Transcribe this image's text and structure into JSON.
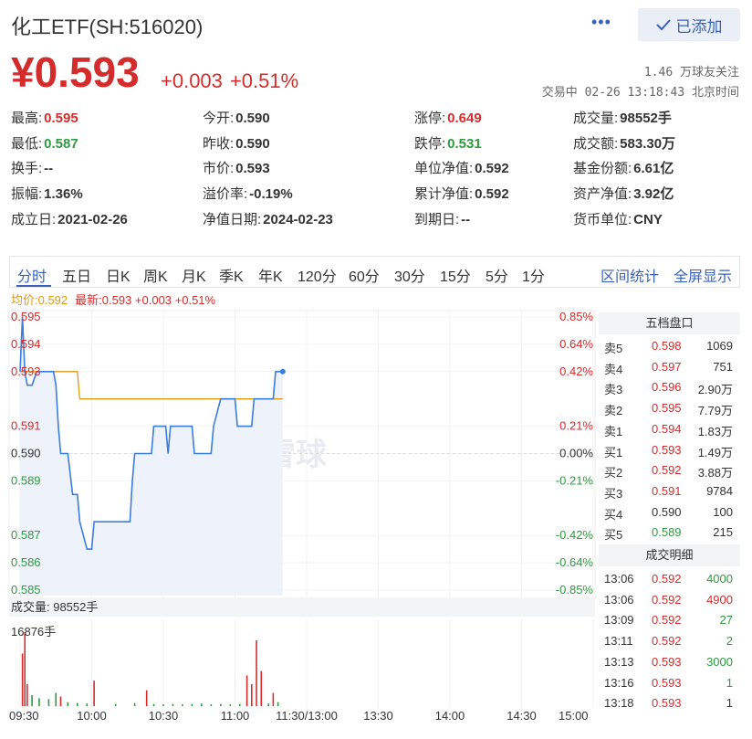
{
  "header": {
    "title": "化工ETF(SH:516020)",
    "more_label": "•••",
    "added_label": "已添加",
    "price": "¥0.593",
    "change": "+0.003",
    "change_pct": "+0.51%",
    "followers": "1.46 万球友关注",
    "trade_status": "交易中 02-26 13:18:43 北京时间"
  },
  "stats": [
    {
      "label": "最高:",
      "value": "0.595",
      "color": "red"
    },
    {
      "label": "今开:",
      "value": "0.590",
      "color": ""
    },
    {
      "label": "涨停:",
      "value": "0.649",
      "color": "red"
    },
    {
      "label": "成交量:",
      "value": "98552手",
      "color": ""
    },
    {
      "label": "最低:",
      "value": "0.587",
      "color": "green"
    },
    {
      "label": "昨收:",
      "value": "0.590",
      "color": ""
    },
    {
      "label": "跌停:",
      "value": "0.531",
      "color": "green"
    },
    {
      "label": "成交额:",
      "value": "583.30万",
      "color": ""
    },
    {
      "label": "换手:",
      "value": "--",
      "color": ""
    },
    {
      "label": "市价:",
      "value": "0.593",
      "color": ""
    },
    {
      "label": "单位净值:",
      "value": "0.592",
      "color": ""
    },
    {
      "label": "基金份额:",
      "value": "6.61亿",
      "color": ""
    },
    {
      "label": "振幅:",
      "value": "1.36%",
      "color": ""
    },
    {
      "label": "溢价率:",
      "value": "-0.19%",
      "color": ""
    },
    {
      "label": "累计净值:",
      "value": "0.592",
      "color": ""
    },
    {
      "label": "资产净值:",
      "value": "3.92亿",
      "color": ""
    },
    {
      "label": "成立日:",
      "value": "2021-02-26",
      "color": ""
    },
    {
      "label": "净值日期:",
      "value": "2024-02-23",
      "color": ""
    },
    {
      "label": "到期日:",
      "value": "--",
      "color": ""
    },
    {
      "label": "货币单位:",
      "value": "CNY",
      "color": ""
    }
  ],
  "tabs": [
    "分时",
    "五日",
    "日K",
    "周K",
    "月K",
    "季K",
    "年K",
    "120分",
    "60分",
    "30分",
    "15分",
    "5分",
    "1分"
  ],
  "tools": [
    "区间统计",
    "全屏显示"
  ],
  "legend": {
    "avg": "均价:0.592",
    "latest": "最新:0.593 +0.003 +0.51%"
  },
  "watermark": "雪球",
  "volume_header": "成交量: 98552手",
  "volume_max": "16876手",
  "order_book": {
    "title": "五档盘口",
    "asks": [
      {
        "label": "卖5",
        "price": "0.598",
        "vol": "1069"
      },
      {
        "label": "卖4",
        "price": "0.597",
        "vol": "751"
      },
      {
        "label": "卖3",
        "price": "0.596",
        "vol": "2.90万"
      },
      {
        "label": "卖2",
        "price": "0.595",
        "vol": "7.79万"
      },
      {
        "label": "卖1",
        "price": "0.594",
        "vol": "1.83万"
      }
    ],
    "bids": [
      {
        "label": "买1",
        "price": "0.593",
        "vol": "1.49万",
        "color": "red"
      },
      {
        "label": "买2",
        "price": "0.592",
        "vol": "3.88万",
        "color": "red"
      },
      {
        "label": "买3",
        "price": "0.591",
        "vol": "9784",
        "color": "red"
      },
      {
        "label": "买4",
        "price": "0.590",
        "vol": "100",
        "color": "neutral"
      },
      {
        "label": "买5",
        "price": "0.589",
        "vol": "215",
        "color": "green"
      }
    ]
  },
  "trades": {
    "title": "成交明细",
    "rows": [
      {
        "time": "13:06",
        "price": "0.592",
        "vol": "4000",
        "color": "green"
      },
      {
        "time": "13:06",
        "price": "0.592",
        "vol": "4900",
        "color": "red"
      },
      {
        "time": "13:09",
        "price": "0.592",
        "vol": "27",
        "color": "green"
      },
      {
        "time": "13:11",
        "price": "0.592",
        "vol": "2",
        "color": "green"
      },
      {
        "time": "13:13",
        "price": "0.593",
        "vol": "3000",
        "color": "green"
      },
      {
        "time": "13:16",
        "price": "0.593",
        "vol": "1",
        "color": "green"
      },
      {
        "time": "13:18",
        "price": "0.593",
        "vol": "1",
        "color": "neutral"
      }
    ]
  },
  "chart_data": {
    "type": "line",
    "y_ticks": [
      "0.595",
      "0.594",
      "0.593",
      "0.591",
      "0.590",
      "0.589",
      "0.587",
      "0.586",
      "0.585"
    ],
    "pct_ticks": [
      "0.85%",
      "0.64%",
      "0.42%",
      "0.21%",
      "0.00%",
      "-0.21%",
      "-0.42%",
      "-0.64%",
      "-0.85%"
    ],
    "x_ticks": [
      "09:30",
      "10:00",
      "10:30",
      "11:00",
      "11:30/13:00",
      "13:30",
      "14:00",
      "14:30",
      "15:00"
    ],
    "ylim": [
      0.585,
      0.595
    ],
    "prev_close": 0.59,
    "series": [
      {
        "name": "最新",
        "color": "#3b7ddd",
        "points": [
          [
            0,
            0.593
          ],
          [
            1,
            0.595
          ],
          [
            2,
            0.593
          ],
          [
            3,
            0.5925
          ],
          [
            5,
            0.5925
          ],
          [
            7,
            0.593
          ],
          [
            14,
            0.593
          ],
          [
            15,
            0.5925
          ],
          [
            16,
            0.591
          ],
          [
            17,
            0.59
          ],
          [
            20,
            0.59
          ],
          [
            22,
            0.5885
          ],
          [
            24,
            0.5885
          ],
          [
            25,
            0.5875
          ],
          [
            28,
            0.5865
          ],
          [
            30,
            0.5865
          ],
          [
            31,
            0.5875
          ],
          [
            46,
            0.5875
          ],
          [
            47,
            0.589
          ],
          [
            48,
            0.59
          ],
          [
            50,
            0.59
          ],
          [
            55,
            0.59
          ],
          [
            56,
            0.591
          ],
          [
            61,
            0.591
          ],
          [
            62,
            0.59
          ],
          [
            63,
            0.591
          ],
          [
            72,
            0.591
          ],
          [
            73,
            0.59
          ],
          [
            80,
            0.59
          ],
          [
            81,
            0.591
          ],
          [
            84,
            0.592
          ],
          [
            90,
            0.592
          ],
          [
            91,
            0.591
          ],
          [
            97,
            0.591
          ],
          [
            98,
            0.592
          ],
          [
            106,
            0.592
          ],
          [
            107,
            0.593
          ],
          [
            110,
            0.593
          ]
        ]
      },
      {
        "name": "均价",
        "color": "#e29a13",
        "points": [
          [
            0,
            0.593
          ],
          [
            1,
            0.593
          ],
          [
            24,
            0.593
          ],
          [
            25,
            0.592
          ],
          [
            110,
            0.592
          ]
        ]
      }
    ],
    "volume": [
      {
        "i": 1,
        "v": 12000,
        "c": "red"
      },
      {
        "i": 2,
        "v": 16876,
        "c": "red"
      },
      {
        "i": 3,
        "v": 5000,
        "c": "red"
      },
      {
        "i": 5,
        "v": 2500,
        "c": "green"
      },
      {
        "i": 8,
        "v": 1800,
        "c": "green"
      },
      {
        "i": 12,
        "v": 1600,
        "c": "green"
      },
      {
        "i": 15,
        "v": 3000,
        "c": "green"
      },
      {
        "i": 17,
        "v": 2200,
        "c": "red"
      },
      {
        "i": 20,
        "v": 900,
        "c": "green"
      },
      {
        "i": 24,
        "v": 700,
        "c": "green"
      },
      {
        "i": 28,
        "v": 600,
        "c": "green"
      },
      {
        "i": 31,
        "v": 5800,
        "c": "red"
      },
      {
        "i": 40,
        "v": 500,
        "c": "green"
      },
      {
        "i": 48,
        "v": 700,
        "c": "green"
      },
      {
        "i": 53,
        "v": 3600,
        "c": "red"
      },
      {
        "i": 56,
        "v": 500,
        "c": "green"
      },
      {
        "i": 60,
        "v": 400,
        "c": "green"
      },
      {
        "i": 64,
        "v": 500,
        "c": "green"
      },
      {
        "i": 68,
        "v": 400,
        "c": "green"
      },
      {
        "i": 72,
        "v": 500,
        "c": "green"
      },
      {
        "i": 76,
        "v": 600,
        "c": "green"
      },
      {
        "i": 80,
        "v": 400,
        "c": "green"
      },
      {
        "i": 84,
        "v": 500,
        "c": "green"
      },
      {
        "i": 88,
        "v": 400,
        "c": "green"
      },
      {
        "i": 92,
        "v": 500,
        "c": "green"
      },
      {
        "i": 95,
        "v": 7000,
        "c": "red"
      },
      {
        "i": 97,
        "v": 5000,
        "c": "red"
      },
      {
        "i": 99,
        "v": 15000,
        "c": "red"
      },
      {
        "i": 101,
        "v": 8000,
        "c": "red"
      },
      {
        "i": 104,
        "v": 600,
        "c": "green"
      },
      {
        "i": 106,
        "v": 3000,
        "c": "red"
      },
      {
        "i": 108,
        "v": 900,
        "c": "green"
      }
    ],
    "total_minutes": 240
  }
}
